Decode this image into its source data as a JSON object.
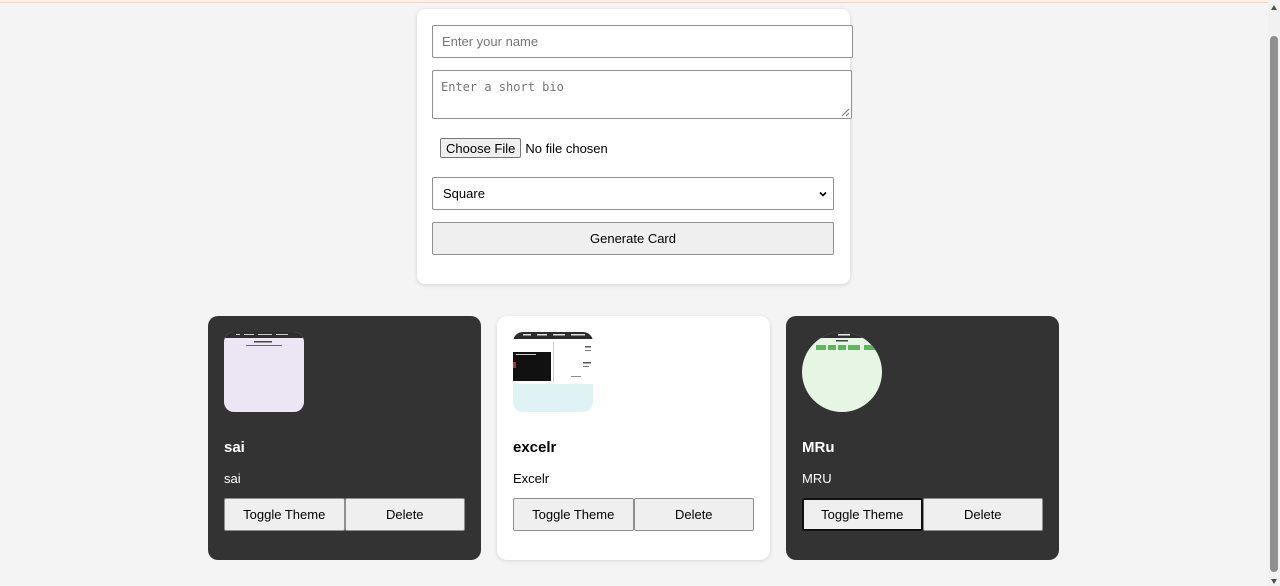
{
  "form": {
    "name_placeholder": "Enter your name",
    "bio_placeholder": "Enter a short bio",
    "file_button_label": "Choose File",
    "file_status": "No file chosen",
    "shape_selected": "Square",
    "generate_label": "Generate Card"
  },
  "cards": [
    {
      "name": "sai",
      "bio": "sai",
      "theme": "dark",
      "shape": "square",
      "image_bg": "#ece6f4",
      "toggle_label": "Toggle Theme",
      "delete_label": "Delete"
    },
    {
      "name": "excelr",
      "bio": "Excelr",
      "theme": "light",
      "shape": "square",
      "image_bg": "#dff3f5",
      "toggle_label": "Toggle Theme",
      "delete_label": "Delete"
    },
    {
      "name": "MRu",
      "bio": "MRU",
      "theme": "dark",
      "shape": "circle",
      "image_bg": "#e7f5e4",
      "toggle_label": "Toggle Theme",
      "delete_label": "Delete"
    }
  ],
  "colors": {
    "page_bg": "#f4f4f4",
    "card_dark_bg": "#333333",
    "card_light_bg": "#ffffff",
    "button_bg": "#efefef"
  }
}
